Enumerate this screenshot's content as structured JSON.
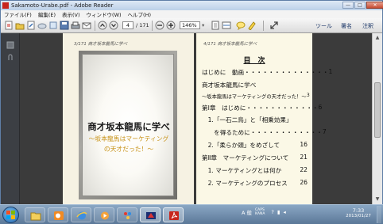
{
  "window": {
    "title": "Sakamoto-Urabe.pdf - Adobe Reader",
    "controls": [
      "—",
      "□",
      "✕"
    ]
  },
  "menu": [
    "ファイル(F)",
    "編集(E)",
    "表示(V)",
    "ウィンドウ(W)",
    "ヘルプ(H)"
  ],
  "toolbar": {
    "page_current": "4",
    "page_total": "/ 171",
    "zoom": "146%",
    "tools_label": "ツール",
    "sign_label": "署名",
    "comment_label": "注釈"
  },
  "left_page": {
    "running_head": "3/171 商才坂本龍馬に学べ",
    "cover_title": "商才坂本龍馬に学べ",
    "cover_subtitle_1": "～坂本龍馬はマーケティング",
    "cover_subtitle_2": "の天才だった！～"
  },
  "right_page": {
    "running_head": "4/171 商才坂本龍馬に学べ",
    "toc_title": "目　次",
    "toc": [
      {
        "text": "はじめに　動画・・・・・・・・・・・・・・",
        "page": "1",
        "small": false
      },
      {
        "text": "商才坂本龍馬に学べ",
        "page": "",
        "small": false
      },
      {
        "text": "～坂本龍馬はマーケティングの天才だった！～",
        "page": "3",
        "small": true
      },
      {
        "text": "第Ⅰ章　はじめに・・・・・・・・・・・・",
        "page": "6",
        "small": false
      },
      {
        "text": "　1.「一石二鳥」と「相乗効果」",
        "page": "",
        "small": false
      },
      {
        "text": "　　を得るために・・・・・・・・・・・・",
        "page": "7",
        "small": false
      },
      {
        "text": "　2.「柔らか頭」をめざして",
        "page": "16",
        "small": false
      },
      {
        "text": "第Ⅱ章　マーケティングについて",
        "page": "21",
        "small": false
      },
      {
        "text": "　1. マーケティングとは何か",
        "page": "22",
        "small": false
      },
      {
        "text": "　2. マーケティングのプロセス",
        "page": "26",
        "small": false
      }
    ]
  },
  "taskbar": {
    "apps": [
      "start-orb",
      "explorer",
      "outlook",
      "ie",
      "media-player",
      "paint",
      "game",
      "adobe-reader"
    ],
    "tray": {
      "ime": "A 般",
      "caps": "CAPS",
      "kana": "KANA"
    },
    "time": "7:33",
    "date": "2013/01/27"
  },
  "colors": {
    "taskbar": "#5b7898",
    "title_bar": "#c9d9ec",
    "cover_subtitle": "#c89319",
    "pdf_red": "#c8261e"
  }
}
